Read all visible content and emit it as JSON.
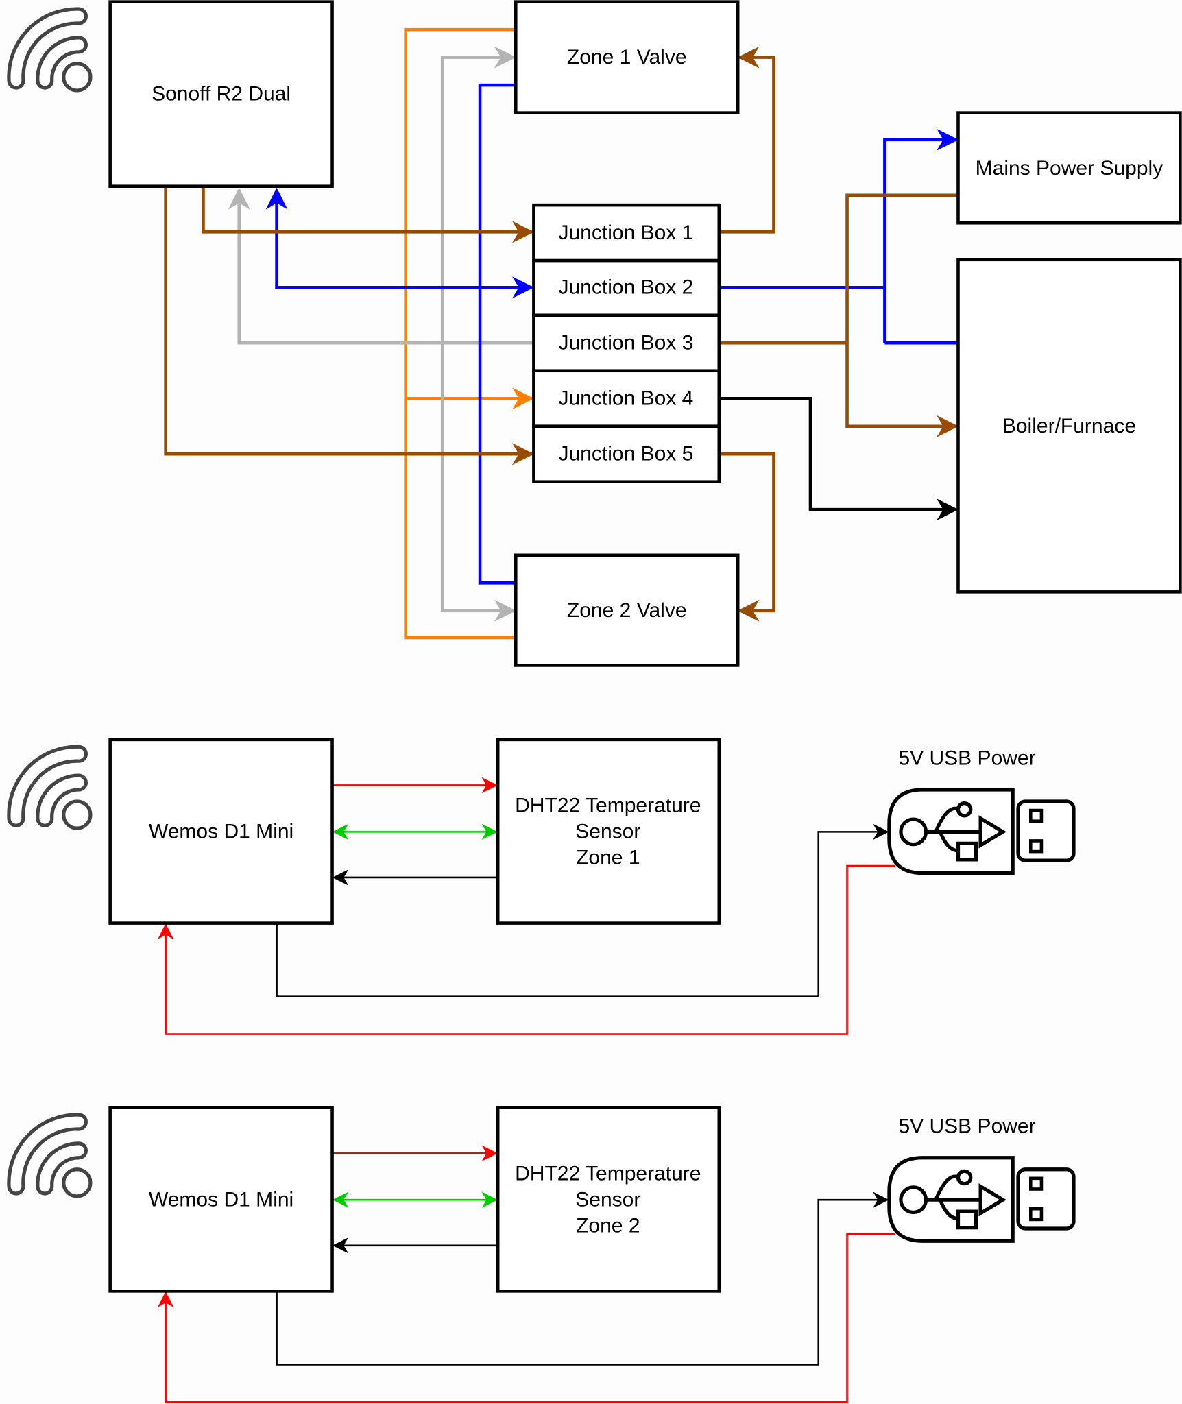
{
  "colors": {
    "orange": "#FF8000",
    "gray": "#B3B3B3",
    "blue": "#0000FF",
    "brown": "#994C00",
    "black": "#000000",
    "red": "#FF0000",
    "green": "#00CC00"
  },
  "relay": {
    "label": "Sonoff R2 Dual"
  },
  "zone1_valve": {
    "label": "Zone 1 Valve"
  },
  "zone2_valve": {
    "label": "Zone 2 Valve"
  },
  "junction_boxes": [
    {
      "label": "Junction Box 1"
    },
    {
      "label": "Junction Box 2"
    },
    {
      "label": "Junction Box 3"
    },
    {
      "label": "Junction Box 4"
    },
    {
      "label": "Junction Box 5"
    }
  ],
  "mains": {
    "label": "Mains Power Supply"
  },
  "boiler": {
    "label": "Boiler/Furnace"
  },
  "sensor_nodes": [
    {
      "controller": "Wemos D1 Mini",
      "sensor_line1": "DHT22 Temperature",
      "sensor_line2": "Sensor",
      "sensor_line3": "Zone 1",
      "power_label": "5V USB Power"
    },
    {
      "controller": "Wemos D1 Mini",
      "sensor_line1": "DHT22 Temperature",
      "sensor_line2": "Sensor",
      "sensor_line3": "Zone 2",
      "power_label": "5V USB Power"
    }
  ],
  "icons": [
    "wifi-icon",
    "usb-plug-icon"
  ]
}
